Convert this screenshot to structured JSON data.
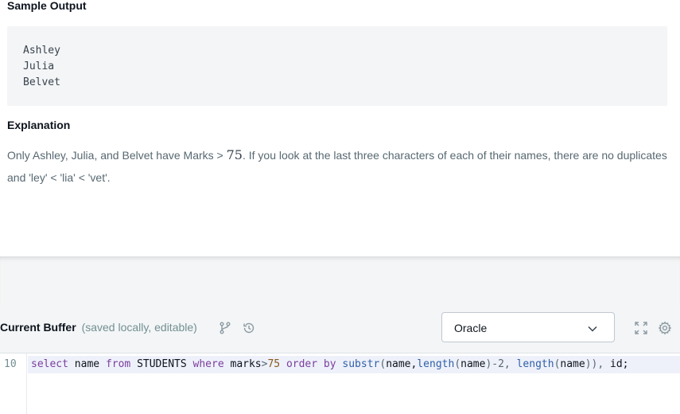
{
  "statement": {
    "sample_output_heading": "Sample Output",
    "sample_output_lines": [
      "Ashley",
      "Julia",
      "Belvet"
    ],
    "explanation_heading": "Explanation",
    "explanation_before_math": "Only Ashley, Julia, and Belvet have Marks > ",
    "explanation_math": "75",
    "explanation_after_math": ". If you look at the last three characters of each of their names, there are no duplicates and 'ley' < 'lia' < 'vet'."
  },
  "editor": {
    "buffer_title": "Current Buffer",
    "buffer_subtitle": "(saved locally, editable)",
    "language": "Oracle",
    "line_number": "10",
    "code_tokens": [
      {
        "text": "select",
        "kind": "kw"
      },
      {
        "text": " name ",
        "kind": "id"
      },
      {
        "text": "from",
        "kind": "kw"
      },
      {
        "text": " STUDENTS ",
        "kind": "id"
      },
      {
        "text": "where",
        "kind": "kw"
      },
      {
        "text": " marks",
        "kind": "id"
      },
      {
        "text": ">",
        "kind": "op"
      },
      {
        "text": "75",
        "kind": "num"
      },
      {
        "text": " ",
        "kind": "id"
      },
      {
        "text": "order by",
        "kind": "kw"
      },
      {
        "text": " ",
        "kind": "id"
      },
      {
        "text": "substr",
        "kind": "fn"
      },
      {
        "text": "(",
        "kind": "op"
      },
      {
        "text": "name,",
        "kind": "id"
      },
      {
        "text": "length",
        "kind": "fn"
      },
      {
        "text": "(",
        "kind": "op"
      },
      {
        "text": "name",
        "kind": "id"
      },
      {
        "text": ")-2, ",
        "kind": "op"
      },
      {
        "text": "length",
        "kind": "fn"
      },
      {
        "text": "(",
        "kind": "op"
      },
      {
        "text": "name",
        "kind": "id"
      },
      {
        "text": ")), ",
        "kind": "op"
      },
      {
        "text": "id;",
        "kind": "id"
      }
    ],
    "icons": {
      "branch": "git-branch-icon",
      "history": "history-icon",
      "dropdown": "chevron-down-icon",
      "fullscreen": "fullscreen-icon",
      "settings": "gear-icon"
    }
  },
  "colors": {
    "heading": "#0e141e",
    "body_text": "#576871",
    "panel_bg": "#f3f5f6",
    "active_line": "#eef1fa",
    "keyword": "#7a3e9d",
    "function": "#2f5fa8"
  }
}
